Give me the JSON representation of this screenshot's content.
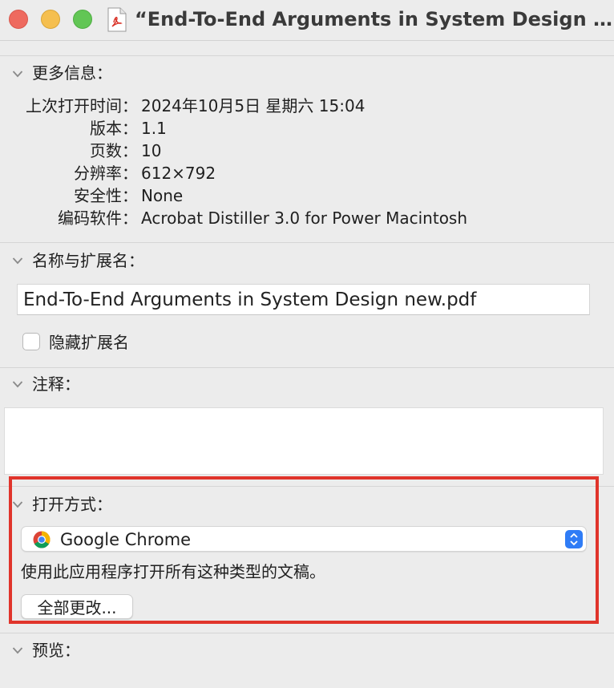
{
  "window": {
    "title": "“End-To-End Arguments in System Design ne...",
    "file_icon": "pdf-document-icon"
  },
  "more_info": {
    "header": "更多信息：",
    "rows": [
      {
        "label": "上次打开时间：",
        "value": "2024年10月5日 星期六 15:04"
      },
      {
        "label": "版本：",
        "value": "1.1"
      },
      {
        "label": "页数：",
        "value": "10"
      },
      {
        "label": "分辨率：",
        "value": "612×792"
      },
      {
        "label": "安全性：",
        "value": "None"
      },
      {
        "label": "编码软件：",
        "value": "Acrobat Distiller 3.0 for Power Macintosh"
      }
    ]
  },
  "name_ext": {
    "header": "名称与扩展名：",
    "filename": "End-To-End Arguments in System Design new.pdf",
    "hide_ext_label": "隐藏扩展名",
    "hide_ext_checked": false
  },
  "comments": {
    "header": "注释：",
    "value": ""
  },
  "open_with": {
    "header": "打开方式：",
    "app": "Google Chrome",
    "app_icon": "chrome-icon",
    "hint": "使用此应用程序打开所有这种类型的文稿。",
    "change_all_label": "全部更改..."
  },
  "preview": {
    "header": "预览："
  },
  "colors": {
    "highlight": "#e0342b",
    "accent": "#2f7cf6"
  }
}
